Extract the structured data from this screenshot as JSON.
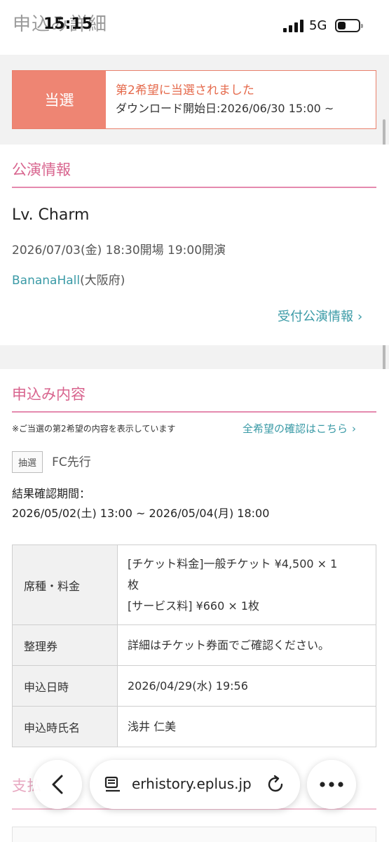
{
  "status": {
    "time": "15:15",
    "network": "5G",
    "ghost_title": "申込み詳細"
  },
  "result": {
    "badge": "当選",
    "title": "第2希望に当選されました",
    "download": "ダウンロード開始日:2026/06/30 15:00 ~"
  },
  "performance": {
    "heading": "公演情報",
    "name": "Lv. Charm",
    "datetime": "2026/07/03(金) 18:30開場 19:00開演",
    "venue": "BananaHall",
    "venue_pref": "(大阪府)",
    "link": "受付公演情報"
  },
  "application": {
    "heading": "申込み内容",
    "note": "※ご当選の第2希望の内容を表示しています",
    "all_link": "全希望の確認はこちら",
    "tag": "抽選",
    "type": "FC先行",
    "period_label": "結果確認期間：",
    "period": "2026/05/02(土) 13:00 ~ 2026/05/04(月) 18:00",
    "table": {
      "seat_label": "席種・料金",
      "seat_line1": "[チケット料金]一般チケット ¥4,500 × 1",
      "seat_line2": "枚",
      "seat_line3": "[サービス料] ¥660 × 1枚",
      "ticket_label": "整理券",
      "ticket_value": "詳細はチケット券面でご確認ください。",
      "date_label": "申込日時",
      "date_value": "2026/04/29(水) 19:56",
      "name_label": "申込時氏名",
      "name_value": "浅井 仁美"
    }
  },
  "next_section": {
    "heading_partial": "支払"
  },
  "browser": {
    "url": "erhistory.eplus.jp"
  },
  "colors": {
    "accent_pink": "#d8648e",
    "result_orange": "#ee8573",
    "link_teal": "#3a9aa6"
  }
}
